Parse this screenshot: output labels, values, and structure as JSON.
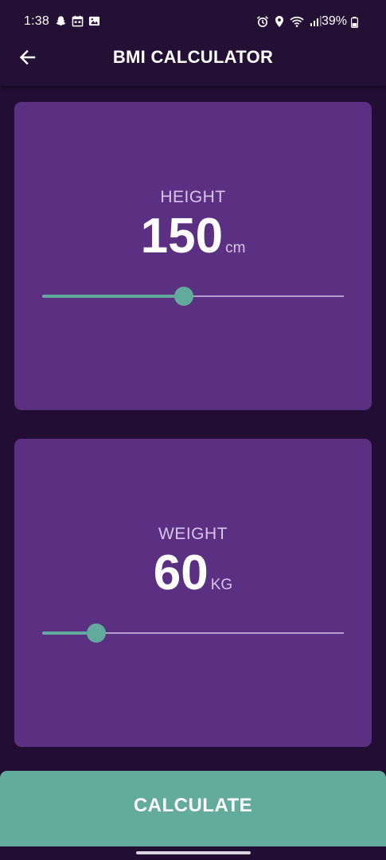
{
  "status_bar": {
    "time": "1:38",
    "battery": "39%",
    "left_icons": [
      "snapchat-icon",
      "calendar-icon",
      "gallery-icon"
    ],
    "right_icons": [
      "alarm-icon",
      "location-icon",
      "wifi-icon",
      "signal-icon",
      "battery-icon"
    ]
  },
  "app_bar": {
    "title": "BMI CALCULATOR",
    "back_icon": "back-arrow-icon"
  },
  "height_card": {
    "label": "HEIGHT",
    "value": "150",
    "unit": "cm",
    "slider_fraction": 0.47
  },
  "weight_card": {
    "label": "WEIGHT",
    "value": "60",
    "unit": "KG",
    "slider_fraction": 0.18
  },
  "calculate_button": {
    "label": "CALCULATE"
  },
  "colors": {
    "background": "#220e33",
    "card": "#5b2f82",
    "accent": "#63ab9b",
    "label": "#d9c5ea"
  }
}
